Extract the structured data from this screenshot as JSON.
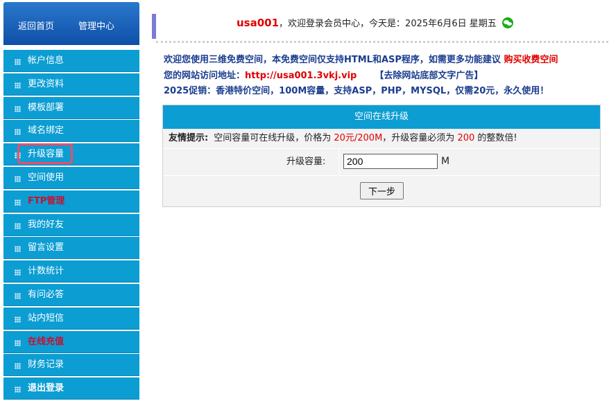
{
  "sidebar": {
    "home_label": "返回首页",
    "admin_label": "管理中心",
    "items": [
      {
        "label": "帐户信息"
      },
      {
        "label": "更改资料"
      },
      {
        "label": "模板部署"
      },
      {
        "label": "域名绑定"
      },
      {
        "label": "升级容量"
      },
      {
        "label": "空间使用"
      },
      {
        "label": "FTP管理"
      },
      {
        "label": "我的好友"
      },
      {
        "label": "留言设置"
      },
      {
        "label": "计数统计"
      },
      {
        "label": "有问必答"
      },
      {
        "label": "站内短信"
      },
      {
        "label": "在线充值"
      },
      {
        "label": "财务记录"
      },
      {
        "label": "退出登录"
      }
    ]
  },
  "header": {
    "username": "usa001",
    "welcome": "，欢迎登录会员中心，今天是：2025年6月6日 星期五"
  },
  "notices": {
    "line1_text": "欢迎您使用三维免费空间，本免费空间仅支持HTML和ASP程序，如需更多功能建议 ",
    "line1_link": "购买收费空间",
    "line2_prefix": "您的网站访问地址：",
    "line2_url": "http://usa001.3vkj.vip",
    "line2_ad_link": "【去除网站底部文字广告】",
    "line3": "2025促销：香港特价空间，100M容量，支持ASP，PHP，MYSQL，仅需20元，永久使用！"
  },
  "panel": {
    "title": "空间在线升级",
    "tip_label": "友情提示:",
    "tip_a": "空间容量可在线升级，价格为 ",
    "tip_price": "20元/200M",
    "tip_b": "，升级容量必须为 ",
    "tip_multiple": "200",
    "tip_c": " 的整数倍!",
    "capacity_label": "升级容量:",
    "capacity_value": "200",
    "capacity_unit": "M",
    "next_label": "下一步"
  }
}
